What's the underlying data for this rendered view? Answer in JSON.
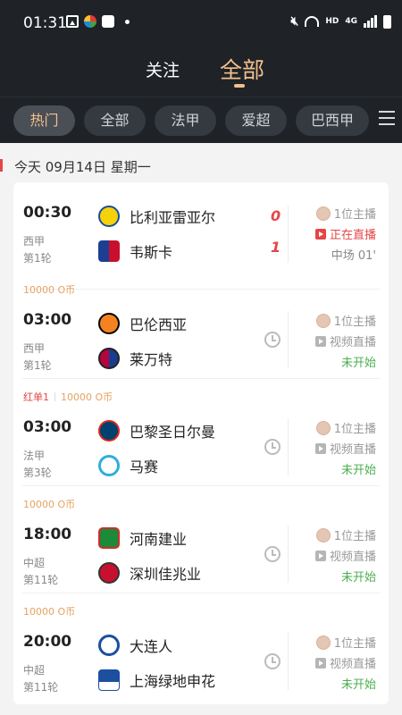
{
  "status_bar": {
    "time": "01:31",
    "hd": "HD",
    "net": "4G"
  },
  "nav": {
    "follow": "关注",
    "all": "全部"
  },
  "filters": [
    "热门",
    "全部",
    "法甲",
    "爱超",
    "巴西甲"
  ],
  "date_label": "今天 09月14日 星期一",
  "colors": {
    "accent": "#f2c08c",
    "live": "#e64545",
    "not_started": "#4caf50",
    "coin": "#e6a261"
  },
  "matches": [
    {
      "tag_red": "",
      "tag_coin": "",
      "time": "00:30",
      "league": "西甲",
      "round": "第1轮",
      "home": "比利亚雷亚尔",
      "away": "韦斯卡",
      "home_score": "0",
      "away_score": "1",
      "anchor": "1位主播",
      "live_label": "正在直播",
      "status": "中场 01'",
      "home_logo": "villarreal-logo",
      "away_logo": "huesca-logo"
    },
    {
      "tag_red": "",
      "tag_coin": "10000 O币",
      "time": "03:00",
      "league": "西甲",
      "round": "第1轮",
      "home": "巴伦西亚",
      "away": "莱万特",
      "anchor": "1位主播",
      "live_label": "视频直播",
      "status": "未开始",
      "home_logo": "valencia-logo",
      "away_logo": "levante-logo"
    },
    {
      "tag_red": "红单1",
      "tag_coin": "10000 O币",
      "time": "03:00",
      "league": "法甲",
      "round": "第3轮",
      "home": "巴黎圣日尔曼",
      "away": "马赛",
      "anchor": "1位主播",
      "live_label": "视频直播",
      "status": "未开始",
      "home_logo": "psg-logo",
      "away_logo": "marseille-logo"
    },
    {
      "tag_red": "",
      "tag_coin": "10000 O币",
      "time": "18:00",
      "league": "中超",
      "round": "第11轮",
      "home": "河南建业",
      "away": "深圳佳兆业",
      "anchor": "1位主播",
      "live_label": "视频直播",
      "status": "未开始",
      "home_logo": "henan-logo",
      "away_logo": "shenzhen-logo"
    },
    {
      "tag_red": "",
      "tag_coin": "10000 O币",
      "time": "20:00",
      "league": "中超",
      "round": "第11轮",
      "home": "大连人",
      "away": "上海绿地申花",
      "anchor": "1位主播",
      "live_label": "视频直播",
      "status": "未开始",
      "home_logo": "dalian-logo",
      "away_logo": "shenhua-logo"
    }
  ]
}
